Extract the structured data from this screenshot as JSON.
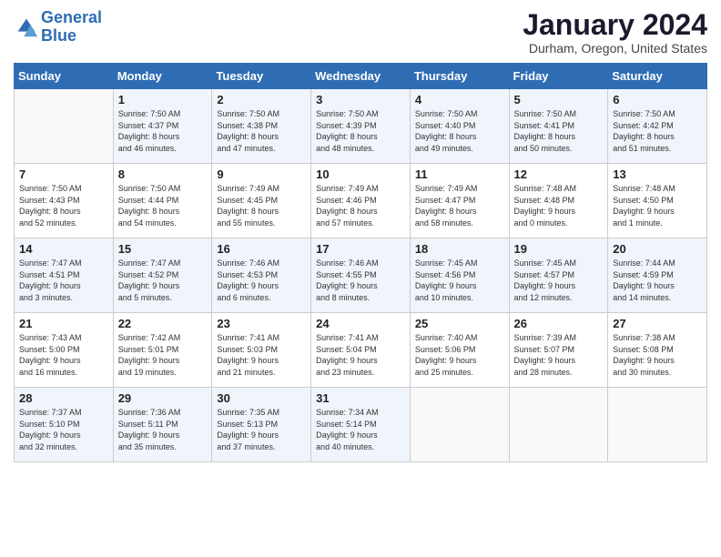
{
  "header": {
    "logo_line1": "General",
    "logo_line2": "Blue",
    "title": "January 2024",
    "location": "Durham, Oregon, United States"
  },
  "days_of_week": [
    "Sunday",
    "Monday",
    "Tuesday",
    "Wednesday",
    "Thursday",
    "Friday",
    "Saturday"
  ],
  "weeks": [
    [
      {
        "day": "",
        "info": ""
      },
      {
        "day": "1",
        "info": "Sunrise: 7:50 AM\nSunset: 4:37 PM\nDaylight: 8 hours\nand 46 minutes."
      },
      {
        "day": "2",
        "info": "Sunrise: 7:50 AM\nSunset: 4:38 PM\nDaylight: 8 hours\nand 47 minutes."
      },
      {
        "day": "3",
        "info": "Sunrise: 7:50 AM\nSunset: 4:39 PM\nDaylight: 8 hours\nand 48 minutes."
      },
      {
        "day": "4",
        "info": "Sunrise: 7:50 AM\nSunset: 4:40 PM\nDaylight: 8 hours\nand 49 minutes."
      },
      {
        "day": "5",
        "info": "Sunrise: 7:50 AM\nSunset: 4:41 PM\nDaylight: 8 hours\nand 50 minutes."
      },
      {
        "day": "6",
        "info": "Sunrise: 7:50 AM\nSunset: 4:42 PM\nDaylight: 8 hours\nand 51 minutes."
      }
    ],
    [
      {
        "day": "7",
        "info": "Sunrise: 7:50 AM\nSunset: 4:43 PM\nDaylight: 8 hours\nand 52 minutes."
      },
      {
        "day": "8",
        "info": "Sunrise: 7:50 AM\nSunset: 4:44 PM\nDaylight: 8 hours\nand 54 minutes."
      },
      {
        "day": "9",
        "info": "Sunrise: 7:49 AM\nSunset: 4:45 PM\nDaylight: 8 hours\nand 55 minutes."
      },
      {
        "day": "10",
        "info": "Sunrise: 7:49 AM\nSunset: 4:46 PM\nDaylight: 8 hours\nand 57 minutes."
      },
      {
        "day": "11",
        "info": "Sunrise: 7:49 AM\nSunset: 4:47 PM\nDaylight: 8 hours\nand 58 minutes."
      },
      {
        "day": "12",
        "info": "Sunrise: 7:48 AM\nSunset: 4:48 PM\nDaylight: 9 hours\nand 0 minutes."
      },
      {
        "day": "13",
        "info": "Sunrise: 7:48 AM\nSunset: 4:50 PM\nDaylight: 9 hours\nand 1 minute."
      }
    ],
    [
      {
        "day": "14",
        "info": "Sunrise: 7:47 AM\nSunset: 4:51 PM\nDaylight: 9 hours\nand 3 minutes."
      },
      {
        "day": "15",
        "info": "Sunrise: 7:47 AM\nSunset: 4:52 PM\nDaylight: 9 hours\nand 5 minutes."
      },
      {
        "day": "16",
        "info": "Sunrise: 7:46 AM\nSunset: 4:53 PM\nDaylight: 9 hours\nand 6 minutes."
      },
      {
        "day": "17",
        "info": "Sunrise: 7:46 AM\nSunset: 4:55 PM\nDaylight: 9 hours\nand 8 minutes."
      },
      {
        "day": "18",
        "info": "Sunrise: 7:45 AM\nSunset: 4:56 PM\nDaylight: 9 hours\nand 10 minutes."
      },
      {
        "day": "19",
        "info": "Sunrise: 7:45 AM\nSunset: 4:57 PM\nDaylight: 9 hours\nand 12 minutes."
      },
      {
        "day": "20",
        "info": "Sunrise: 7:44 AM\nSunset: 4:59 PM\nDaylight: 9 hours\nand 14 minutes."
      }
    ],
    [
      {
        "day": "21",
        "info": "Sunrise: 7:43 AM\nSunset: 5:00 PM\nDaylight: 9 hours\nand 16 minutes."
      },
      {
        "day": "22",
        "info": "Sunrise: 7:42 AM\nSunset: 5:01 PM\nDaylight: 9 hours\nand 19 minutes."
      },
      {
        "day": "23",
        "info": "Sunrise: 7:41 AM\nSunset: 5:03 PM\nDaylight: 9 hours\nand 21 minutes."
      },
      {
        "day": "24",
        "info": "Sunrise: 7:41 AM\nSunset: 5:04 PM\nDaylight: 9 hours\nand 23 minutes."
      },
      {
        "day": "25",
        "info": "Sunrise: 7:40 AM\nSunset: 5:06 PM\nDaylight: 9 hours\nand 25 minutes."
      },
      {
        "day": "26",
        "info": "Sunrise: 7:39 AM\nSunset: 5:07 PM\nDaylight: 9 hours\nand 28 minutes."
      },
      {
        "day": "27",
        "info": "Sunrise: 7:38 AM\nSunset: 5:08 PM\nDaylight: 9 hours\nand 30 minutes."
      }
    ],
    [
      {
        "day": "28",
        "info": "Sunrise: 7:37 AM\nSunset: 5:10 PM\nDaylight: 9 hours\nand 32 minutes."
      },
      {
        "day": "29",
        "info": "Sunrise: 7:36 AM\nSunset: 5:11 PM\nDaylight: 9 hours\nand 35 minutes."
      },
      {
        "day": "30",
        "info": "Sunrise: 7:35 AM\nSunset: 5:13 PM\nDaylight: 9 hours\nand 37 minutes."
      },
      {
        "day": "31",
        "info": "Sunrise: 7:34 AM\nSunset: 5:14 PM\nDaylight: 9 hours\nand 40 minutes."
      },
      {
        "day": "",
        "info": ""
      },
      {
        "day": "",
        "info": ""
      },
      {
        "day": "",
        "info": ""
      }
    ]
  ]
}
